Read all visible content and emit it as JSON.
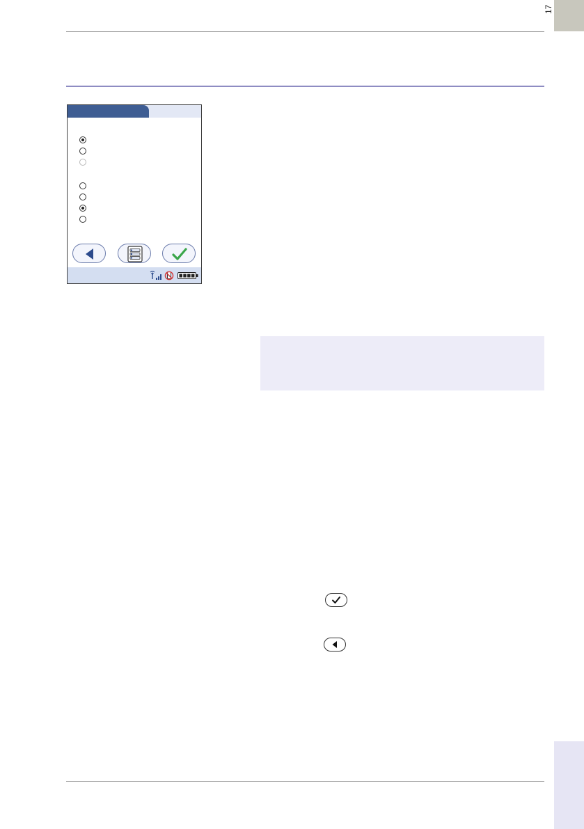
{
  "page": {
    "page_number": "17"
  },
  "device_screen": {
    "tab_title": "",
    "radio_groups": [
      {
        "options": [
          {
            "state": "selected"
          },
          {
            "state": "unselected"
          },
          {
            "state": "disabled"
          }
        ]
      },
      {
        "options": [
          {
            "state": "unselected"
          },
          {
            "state": "unselected"
          },
          {
            "state": "selected"
          },
          {
            "state": "unselected"
          }
        ]
      }
    ],
    "buttons": {
      "back_icon": "back-triangle-icon",
      "menu_icon": "menu-list-icon",
      "confirm_icon": "checkmark-icon"
    },
    "status_icons": [
      "wireless-antenna-icon",
      "signal-bars-icon",
      "no-mobile-phone-icon",
      "battery-icon"
    ]
  },
  "inline_keys": {
    "confirm": "checkmark-key-icon",
    "back": "back-key-icon"
  },
  "colors": {
    "section_rule": "#8e8cc2",
    "tab_active": "#3e5d93",
    "tab_inactive": "#e3e8f5",
    "status_bar": "#d4def1",
    "note_box": "#edecf8",
    "side_tab_top": "#c8c7bd",
    "side_tab_bottom": "#e6e5f4",
    "confirm_green": "#3aa64a",
    "back_blue": "#2c4b8c"
  }
}
